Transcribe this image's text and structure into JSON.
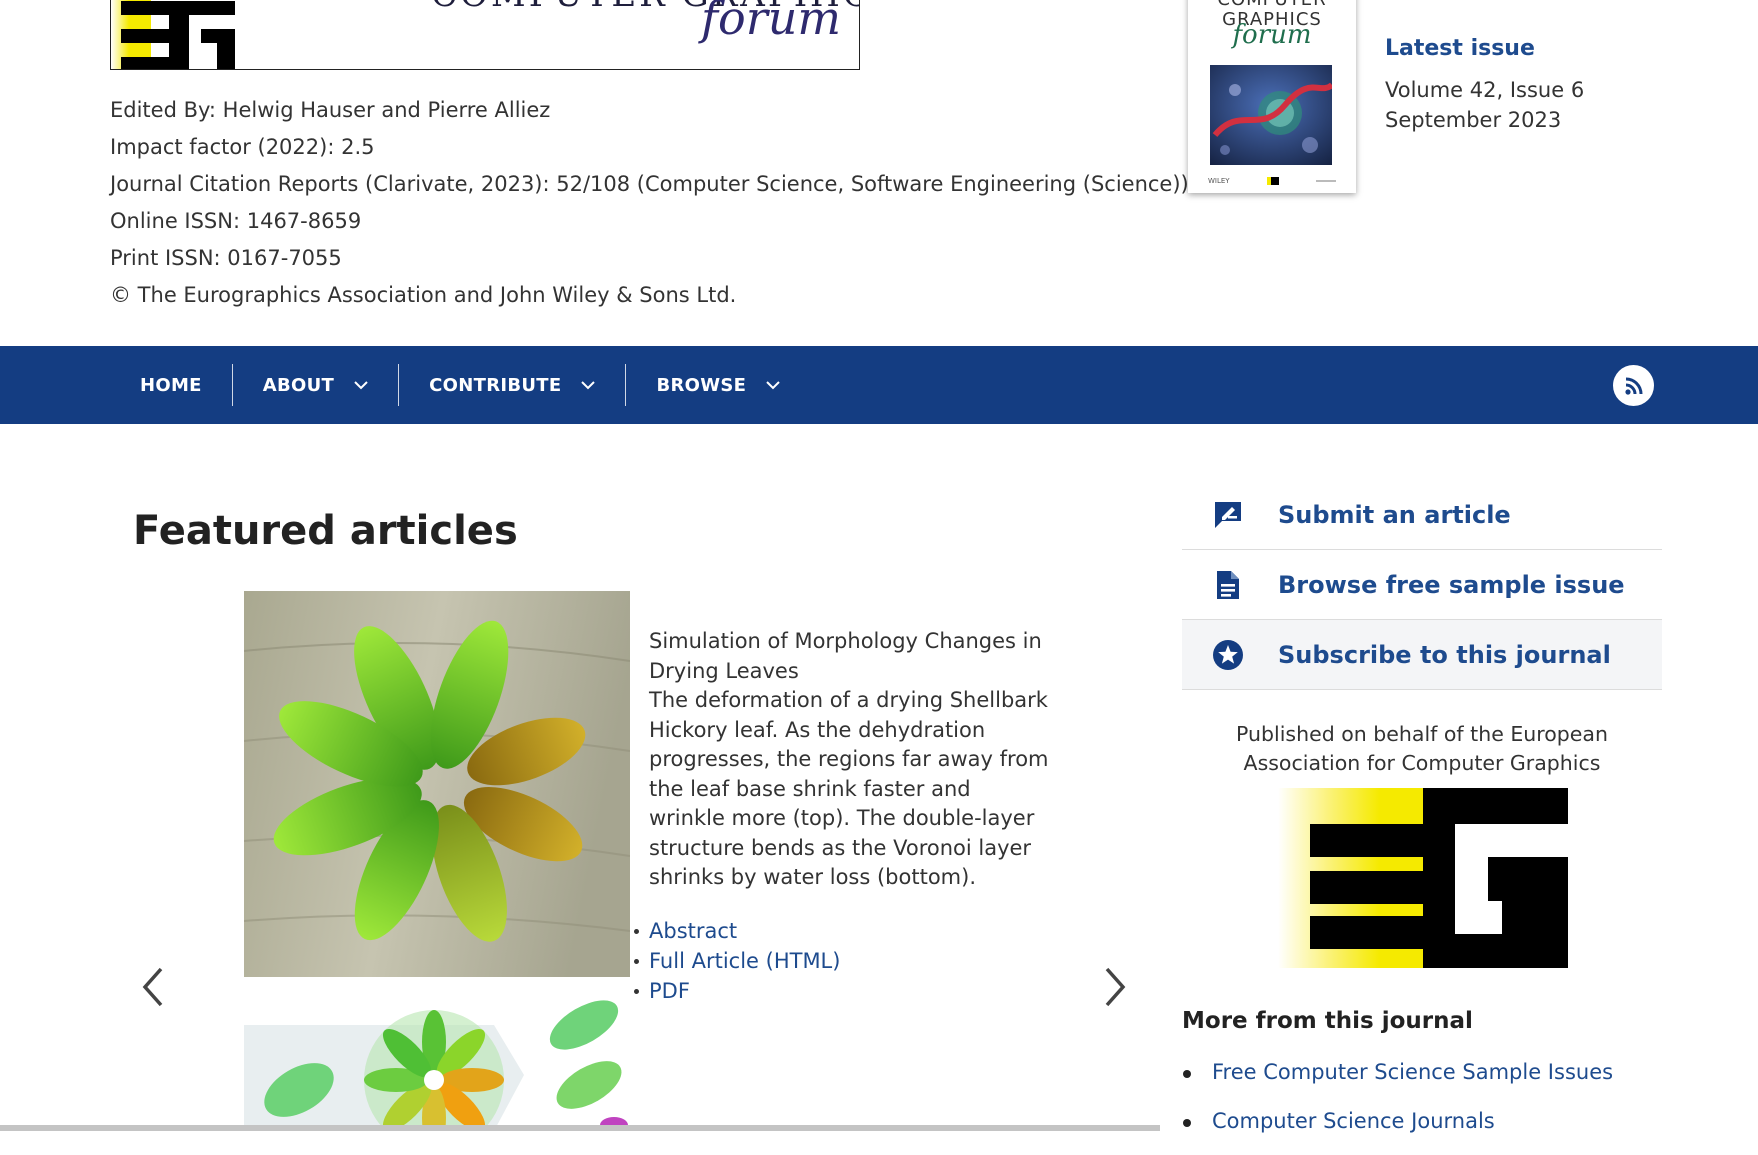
{
  "header": {
    "banner_title": "COMPUTER GRAPHICS",
    "banner_forum": "forum",
    "meta": [
      "Edited By: Helwig Hauser and Pierre Alliez",
      "Impact factor (2022): 2.5",
      "Journal Citation Reports (Clarivate, 2023):  52/108 (Computer Science, Software Engineering (Science))",
      "Online ISSN: 1467-8659",
      "Print ISSN: 0167-7055",
      "© The Eurographics Association and John Wiley & Sons Ltd."
    ],
    "cover": {
      "title": "COMPUTER GRAPHICS",
      "forum": "forum",
      "publisher": "WILEY"
    },
    "latest_issue": {
      "link": "Latest issue",
      "volume": "Volume 42, Issue 6",
      "date": "September 2023"
    }
  },
  "nav": {
    "items": [
      {
        "label": "HOME",
        "dropdown": false
      },
      {
        "label": "ABOUT",
        "dropdown": true
      },
      {
        "label": "CONTRIBUTE",
        "dropdown": true
      },
      {
        "label": "BROWSE",
        "dropdown": true
      }
    ],
    "rss_icon": "rss-icon"
  },
  "featured": {
    "heading": "Featured articles",
    "article_title": "Simulation of Morphology Changes in Drying Leaves",
    "article_description": "The deformation of a drying Shellbark Hickory leaf. As the dehydration progresses, the regions far away from the leaf base shrink faster and wrinkle more (top). The double-layer structure bends as the Voronoi layer shrinks by water loss (bottom).",
    "links": [
      "Abstract",
      "Full Article (HTML)",
      "PDF"
    ]
  },
  "sidebar": {
    "actions": [
      {
        "label": "Submit an article",
        "icon": "edit-note-icon"
      },
      {
        "label": "Browse free sample issue",
        "icon": "document-icon"
      },
      {
        "label": "Subscribe to this journal",
        "icon": "star-badge-icon"
      }
    ],
    "published_on_behalf": "Published on behalf of the European Association for Computer Graphics",
    "more_title": "More from this journal",
    "more_links": [
      "Free Computer Science Sample Issues",
      "Computer Science Journals"
    ]
  },
  "colors": {
    "nav_bg": "#143d82",
    "link": "#1e4b8e",
    "eg_yellow": "#f5ea00"
  }
}
